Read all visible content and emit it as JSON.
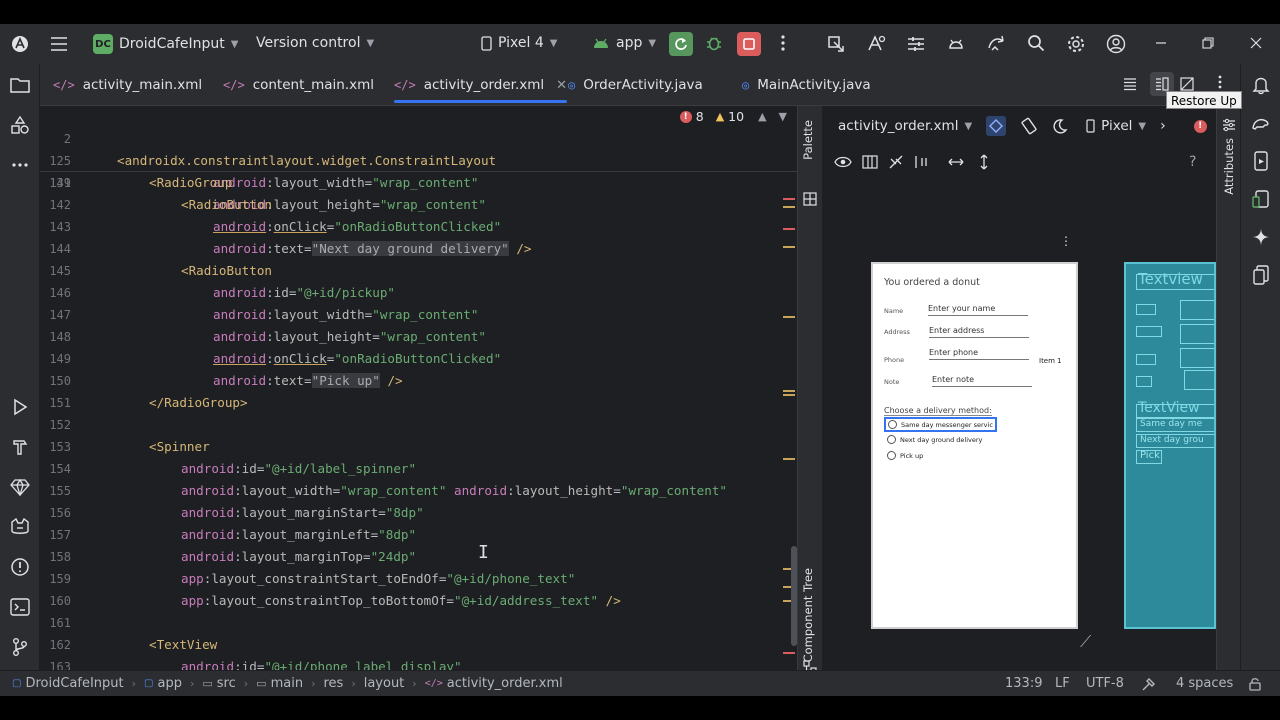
{
  "titlebar": {
    "project_badge": "DC",
    "project_name": "DroidCafeInput",
    "vcs_label": "Version control",
    "device": "Pixel 4",
    "run_config": "app"
  },
  "tabs": [
    {
      "label": "activity_main.xml",
      "type": "xml"
    },
    {
      "label": "content_main.xml",
      "type": "xml"
    },
    {
      "label": "activity_order.xml",
      "type": "xml",
      "active": true
    },
    {
      "label": "OrderActivity.java",
      "type": "java"
    },
    {
      "label": "MainActivity.java",
      "type": "java"
    }
  ],
  "tooltip": "Restore Up",
  "inspections": {
    "errors": "8",
    "warnings": "10"
  },
  "editor": {
    "sticky": [
      {
        "num": "2",
        "text": "<androidx.constraintlayout.widget.ConstraintLayout"
      },
      {
        "num": "125",
        "text": "<RadioGroup"
      },
      {
        "num": "139",
        "text": "<RadioButton"
      }
    ],
    "lines": [
      {
        "num": "141",
        "indent": 3,
        "ns": "android",
        "attr": "layout_width",
        "val": "\"wrap_content\""
      },
      {
        "num": "142",
        "indent": 3,
        "ns": "android",
        "attr": "layout_height",
        "val": "\"wrap_content\""
      },
      {
        "num": "143",
        "indent": 3,
        "ns": "android",
        "attr": "onClick",
        "val": "\"onRadioButtonClicked\"",
        "warn": true
      },
      {
        "num": "144",
        "indent": 3,
        "ns": "android",
        "attr": "text",
        "lit": "\"Next day ground delivery\"",
        "tail": " />"
      },
      {
        "num": "145",
        "indent": 2,
        "tag": "<RadioButton"
      },
      {
        "num": "146",
        "indent": 3,
        "ns": "android",
        "attr": "id",
        "val": "\"@+id/pickup\""
      },
      {
        "num": "147",
        "indent": 3,
        "ns": "android",
        "attr": "layout_width",
        "val": "\"wrap_content\""
      },
      {
        "num": "148",
        "indent": 3,
        "ns": "android",
        "attr": "layout_height",
        "val": "\"wrap_content\""
      },
      {
        "num": "149",
        "indent": 3,
        "ns": "android",
        "attr": "onClick",
        "val": "\"onRadioButtonClicked\"",
        "warn": true
      },
      {
        "num": "150",
        "indent": 3,
        "ns": "android",
        "attr": "text",
        "lit": "\"Pick up\"",
        "tail": " />"
      },
      {
        "num": "151",
        "indent": 1,
        "tag": "</RadioGroup>"
      },
      {
        "num": "152",
        "indent": 0,
        "blank": true
      },
      {
        "num": "153",
        "indent": 1,
        "tag": "<Spinner"
      },
      {
        "num": "154",
        "indent": 2,
        "ns": "android",
        "attr": "id",
        "val": "\"@+id/label_spinner\""
      },
      {
        "num": "155",
        "indent": 2,
        "ns": "android",
        "attr": "layout_width",
        "val": "\"wrap_content\"",
        "ns2": "android",
        "attr2": "layout_height",
        "val2": "\"wrap_content\""
      },
      {
        "num": "156",
        "indent": 2,
        "ns": "android",
        "attr": "layout_marginStart",
        "val": "\"8dp\""
      },
      {
        "num": "157",
        "indent": 2,
        "ns": "android",
        "attr": "layout_marginLeft",
        "val": "\"8dp\""
      },
      {
        "num": "158",
        "indent": 2,
        "ns": "android",
        "attr": "layout_marginTop",
        "val": "\"24dp\""
      },
      {
        "num": "159",
        "indent": 2,
        "ns": "app",
        "attr": "layout_constraintStart_toEndOf",
        "val": "\"@+id/phone_text\""
      },
      {
        "num": "160",
        "indent": 2,
        "ns": "app",
        "attr": "layout_constraintTop_toBottomOf",
        "val": "\"@+id/address_text\"",
        "tail": " />"
      },
      {
        "num": "161",
        "indent": 0,
        "blank": true
      },
      {
        "num": "162",
        "indent": 1,
        "tag": "<TextView"
      },
      {
        "num": "163",
        "indent": 2,
        "ns": "android",
        "attr": "id",
        "val": "\"@+id/phone_label_display\""
      }
    ]
  },
  "side_tabs": {
    "palette": "Palette",
    "component_tree": "Component Tree",
    "attributes": "Attributes"
  },
  "design": {
    "file": "activity_order.xml",
    "device": "Pixel",
    "preview": {
      "title": "You ordered a donut",
      "labels": {
        "name": "Name",
        "address": "Address",
        "phone": "Phone",
        "note": "Note"
      },
      "fields": {
        "name": "Enter your name",
        "address": "Enter address",
        "phone": "Enter phone",
        "note": "Enter note"
      },
      "spinner_item": "Item 1",
      "choose": "Choose a delivery method:",
      "radios": [
        "Same day messenger servic",
        "Next day ground delivery",
        "Pick up"
      ]
    },
    "blueprint": {
      "text1": "Textview",
      "text2": "TextView",
      "small": "TextView",
      "r1": "Same day me",
      "r2": "Next day grou",
      "r3": "Pick"
    }
  },
  "statusbar": {
    "crumbs": [
      "DroidCafeInput",
      "app",
      "src",
      "main",
      "res",
      "layout",
      "activity_order.xml"
    ],
    "position": "133:9",
    "line_sep": "LF",
    "encoding": "UTF-8",
    "indent": "4 spaces"
  },
  "colors": {
    "accent": "#3574f0",
    "run": "#57965c",
    "stop": "#db5c5c"
  }
}
